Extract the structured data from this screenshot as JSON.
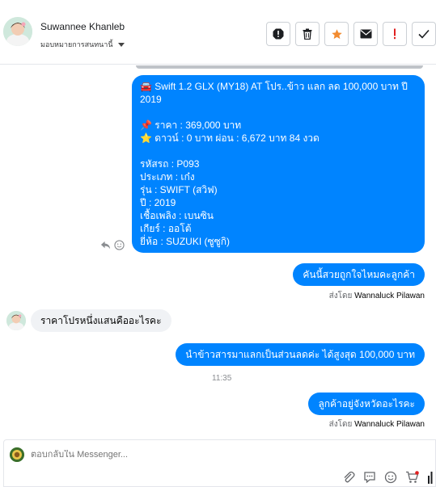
{
  "header": {
    "contact_name": "Suwannee Khanleb",
    "assign_label": "มอบหมายการสนทนานี้"
  },
  "toolbar": {
    "spam_label": "Mark as spam",
    "delete_label": "Delete",
    "star_label": "Star",
    "email_label": "Mark as unread",
    "follow_up_label": "Follow up",
    "done_label": "Done"
  },
  "messages": {
    "car_listing": [
      "🚘 Swift 1.2 GLX (MY18) AT โปร..ข้าว แลก ลด 100,000 บาท ปี 2019",
      "",
      "📌 ราคา : 369,000 บาท",
      "⭐ ดาวน์ : 0 บาท ผ่อน : 6,672 บาท 84 งวด",
      "",
      "   รหัสรถ : P093",
      "   ประเภท : เก๋ง",
      "   รุ่น : SWIFT (สวิฟ)",
      "   ปี : 2019",
      "   เชื้อเพลิง : เบนซิน",
      "   เกียร์ : ออโต้",
      "   ยี่ห้อ : SUZUKI (ซูซูกิ)"
    ],
    "reply_1": "คันนี้สวยถูกใจไหมคะลูกค้า",
    "sent_by_label": "ส่งโดย",
    "sent_by_name_1": "Wannaluck Pilawan",
    "customer_msg": "ราคาโปรหนึ่งแสนคืออะไรคะ",
    "reply_2": "นำข้าวสารมาแลกเป็นส่วนลดค่ะ  ได้สูงสุด 100,000 บาท",
    "timestamp": "11:35",
    "reply_3": "ลูกค้าอยู่จังหวัดอะไรคะ",
    "sent_by_name_2": "Wannaluck Pilawan"
  },
  "composer": {
    "placeholder": "ตอบกลับใน Messenger..."
  },
  "colors": {
    "outgoing_bubble": "#0084ff",
    "incoming_bubble": "#f0f2f5",
    "star_accent": "#f28b30",
    "follow_up_accent": "#e02020"
  }
}
